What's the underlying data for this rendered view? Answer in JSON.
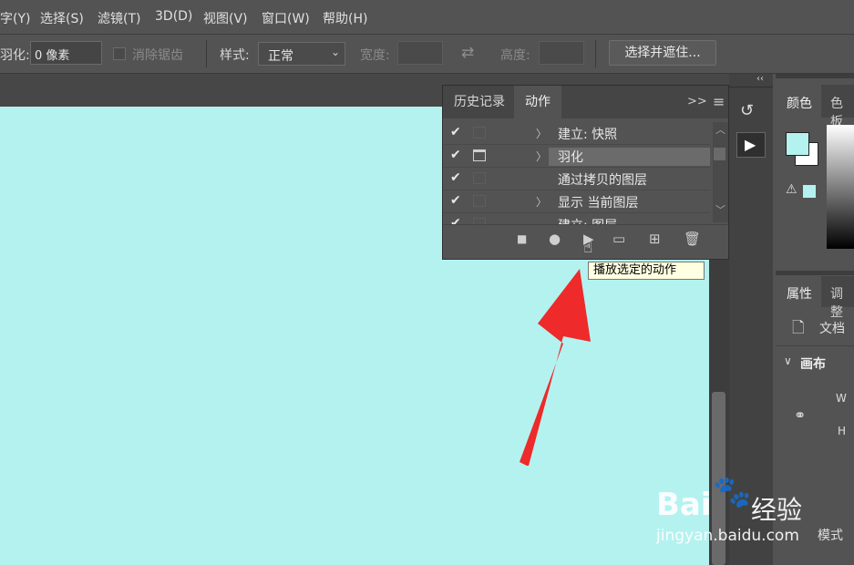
{
  "menu": [
    "字(Y)",
    "选择(S)",
    "滤镜(T)",
    "3D(D)",
    "视图(V)",
    "窗口(W)",
    "帮助(H)"
  ],
  "options": {
    "feather_label": "羽化:",
    "feather_value": "0 像素",
    "antialias_label": "消除锯齿",
    "style_label": "样式:",
    "style_value": "正常",
    "width_label": "宽度:",
    "height_label": "高度:",
    "select_mask_button": "选择并遮住..."
  },
  "actions_panel": {
    "tabs": [
      "历史记录",
      "动作"
    ],
    "active_tab": "动作",
    "menu_glyph": "≡",
    "expand_glyph": ">>",
    "rows": [
      {
        "label": "建立: 快照",
        "checked": true,
        "selected": false
      },
      {
        "label": "羽化",
        "checked": true,
        "selected": true
      },
      {
        "label": "通过拷贝的图层",
        "checked": true,
        "selected": false
      },
      {
        "label": "显示 当前图层",
        "checked": true,
        "selected": false
      },
      {
        "label": "建立: 图层",
        "checked": true,
        "selected": false
      }
    ],
    "footer_buttons": [
      "stop-icon",
      "record-icon",
      "play-icon",
      "folder-icon",
      "new-action-icon",
      "trash-icon"
    ]
  },
  "tooltip": "播放选定的动作",
  "right_panel": {
    "color_tab": "颜色",
    "swatches_tab": "色板",
    "properties_tab": "属性",
    "adjust_tab": "调整",
    "doc_label": "文档",
    "canvas_section": "画布",
    "w_label": "W",
    "h_label": "H",
    "mode_label": "模式"
  },
  "watermark": {
    "brand": "Bai",
    "brand2": "经验",
    "url": "jingyan.baidu.com"
  },
  "colors": {
    "canvas": "#b4f2f0",
    "arrow": "#ee2a2a",
    "accent": "#b4f2f0"
  }
}
